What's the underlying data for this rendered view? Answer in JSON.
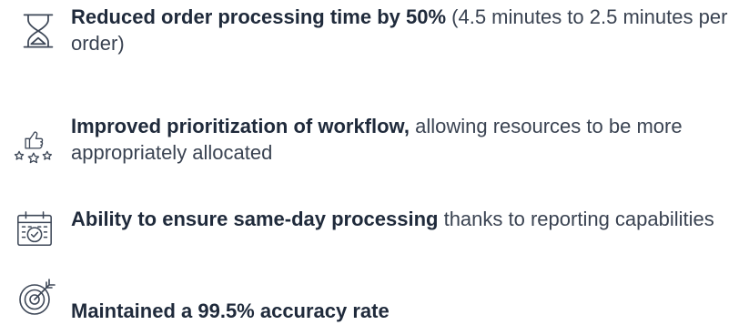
{
  "items": [
    {
      "icon": "hourglass-icon",
      "bold": "Reduced order processing time by 50%",
      "normal": " (4.5 minutes to 2.5 minutes per order)"
    },
    {
      "icon": "thumbs-up-stars-icon",
      "bold": "Improved prioritization of workflow,",
      "normal": "  allowing resources to be more appropriately allocated"
    },
    {
      "icon": "calendar-check-icon",
      "bold": "Ability to ensure same-day processing",
      "normal": "  thanks to reporting capabilities"
    },
    {
      "icon": "target-icon",
      "bold": "Maintained a 99.5% accuracy rate",
      "normal": ""
    }
  ],
  "colors": {
    "text": "#3a4352",
    "bold_text": "#1f2a3b",
    "icon_stroke": "#3d4757"
  }
}
